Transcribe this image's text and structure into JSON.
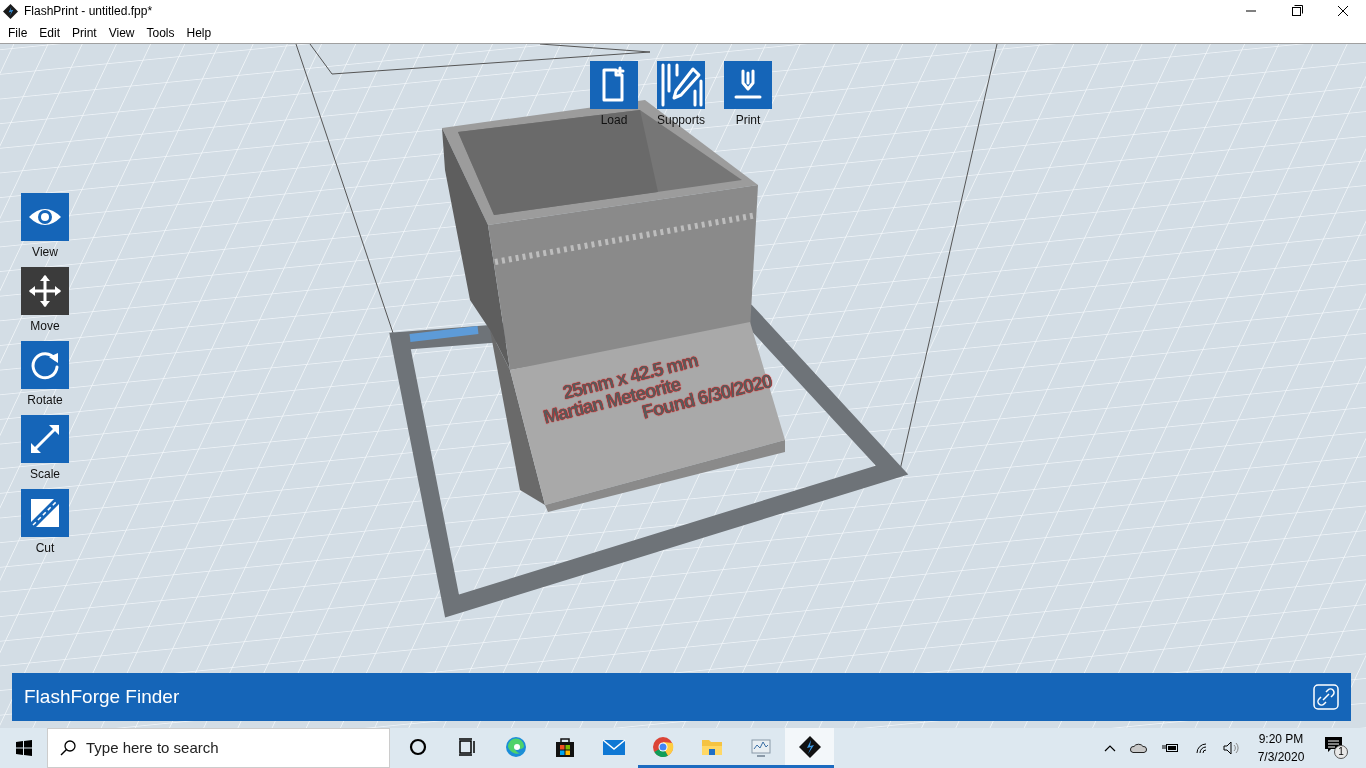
{
  "window": {
    "title": "FlashPrint - untitled.fpp*"
  },
  "menu": [
    "File",
    "Edit",
    "Print",
    "View",
    "Tools",
    "Help"
  ],
  "top_actions": [
    {
      "kind": "load",
      "label": "Load"
    },
    {
      "kind": "supports",
      "label": "Supports"
    },
    {
      "kind": "print",
      "label": "Print"
    }
  ],
  "tools": [
    {
      "kind": "view",
      "label": "View",
      "selected": false
    },
    {
      "kind": "move",
      "label": "Move",
      "selected": true
    },
    {
      "kind": "rotate",
      "label": "Rotate",
      "selected": false
    },
    {
      "kind": "scale",
      "label": "Scale",
      "selected": false
    },
    {
      "kind": "cut",
      "label": "Cut",
      "selected": false
    }
  ],
  "model_text": [
    "25mm x 42.5 mm",
    "Martian Meteorite",
    "Found 6/30/2020"
  ],
  "finder_bar": {
    "title": "FlashForge Finder"
  },
  "taskbar": {
    "search": {
      "placeholder": "Type here to search"
    },
    "apps": [
      {
        "kind": "cortana",
        "running": false,
        "selected": false
      },
      {
        "kind": "taskview",
        "running": false,
        "selected": false
      },
      {
        "kind": "edge",
        "running": false,
        "selected": false
      },
      {
        "kind": "store",
        "running": false,
        "selected": false
      },
      {
        "kind": "mail",
        "running": false,
        "selected": false
      },
      {
        "kind": "chrome",
        "running": true,
        "selected": false
      },
      {
        "kind": "explorer",
        "running": true,
        "selected": false
      },
      {
        "kind": "monitor",
        "running": true,
        "selected": false
      },
      {
        "kind": "flashprint",
        "running": true,
        "selected": true
      }
    ],
    "time": "9:20 PM",
    "date": "7/3/2020",
    "notifications": "1"
  }
}
